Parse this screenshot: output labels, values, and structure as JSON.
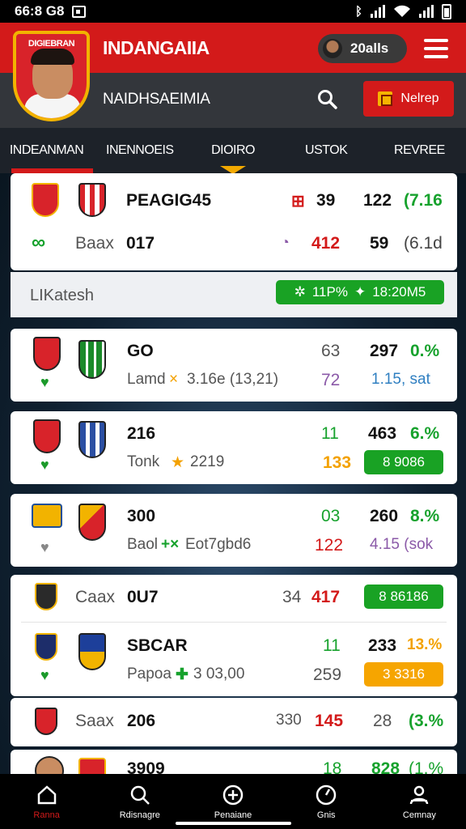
{
  "status_bar": {
    "time": "66:8 G8",
    "indicator": "ᛒ"
  },
  "header": {
    "crest_text": "DIGIEBRAN",
    "title": "INDANGAIIA",
    "user_label": "20alls",
    "subtitle": "NAIDHSAEIMIA",
    "action_label": "Nelrep"
  },
  "tabs": [
    {
      "label": "INDEANMAN"
    },
    {
      "label": "INENNOEIS"
    },
    {
      "label": "DIOIRO"
    },
    {
      "label": "USTOK"
    },
    {
      "label": "REVREE"
    }
  ],
  "top_card": {
    "row1": {
      "name": "PEAGIG45",
      "v1": "39",
      "v2": "122",
      "v3": "(7.16"
    },
    "row2": {
      "name": "Baax",
      "code": "017",
      "v1": "412",
      "v2": "59",
      "v3": "(6.1d"
    }
  },
  "section": {
    "label": "LIKatesh",
    "pill_left": "11P%",
    "pill_right": "18:20M5"
  },
  "matches": [
    {
      "title": "GO",
      "detail": "Lamd",
      "detail2": "3.16e (13,21)",
      "v1": "63",
      "v2": "297",
      "v3": "0.%",
      "v4": "72",
      "v5": "1.15, sat"
    },
    {
      "title": "216",
      "detail": "Tonk",
      "detail2": "2219",
      "v1": "11",
      "v2": "463",
      "v3": "6.%",
      "v4": "133",
      "pill": "8 9086"
    },
    {
      "title": "300",
      "detail": "Baol",
      "detail2": "Eot7gbd6",
      "v1": "03",
      "v2": "260",
      "v3": "8.%",
      "v4": "122",
      "v5": "4.15 (sok"
    },
    {
      "title": "Caax",
      "code": "0U7",
      "v1": "34",
      "v2": "417",
      "pill": "8 86186"
    },
    {
      "title": "SBCAR",
      "detail": "Papoa",
      "detail2": "3 03,00",
      "v1": "11",
      "v2": "233",
      "v3": "13.%",
      "v4": "259",
      "pill": "3 3316"
    },
    {
      "title": "Saax",
      "code": "206",
      "v1": "330",
      "v2": "145",
      "v3": "28",
      "v4": "(3.%"
    },
    {
      "title": "3909",
      "v1": "18",
      "v2": "828",
      "v3": "(1.%"
    }
  ],
  "bottom_nav": [
    {
      "label": "Ranna"
    },
    {
      "label": "Rdisnagre"
    },
    {
      "label": "Penaiane"
    },
    {
      "label": "Gnis"
    },
    {
      "label": "Cemnay"
    }
  ]
}
